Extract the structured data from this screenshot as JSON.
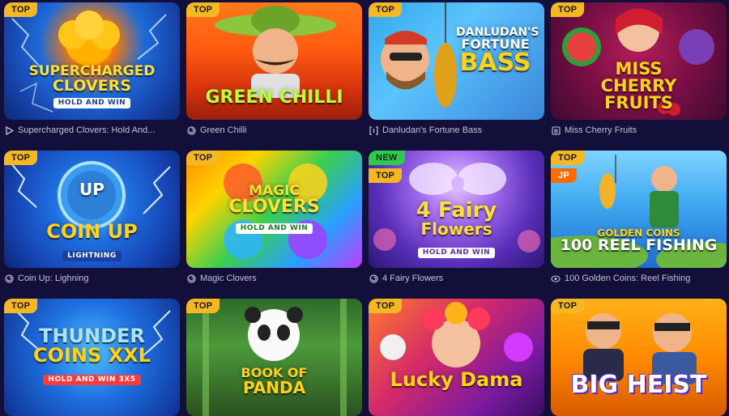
{
  "colors": {
    "page_bg": "#120f3a",
    "badge_top": "#f5b823",
    "badge_new": "#2ecc4d",
    "badge_jp": "#ff6a00",
    "label_text": "#c3c2d6"
  },
  "games": [
    {
      "name": "Supercharged Clovers: Hold And...",
      "provider_icon": "play-triangle-icon",
      "badges": [
        "TOP"
      ],
      "art_title_lines": [
        "SUPERCHARGED",
        "CLOVERS"
      ],
      "art_subtitle": "HOLD AND WIN"
    },
    {
      "name": "Green Chilli",
      "provider_icon": "spiral-provider-icon",
      "badges": [
        "TOP"
      ],
      "art_title_lines": [
        "GREEN CHILLI"
      ],
      "art_subtitle": ""
    },
    {
      "name": "Danludan's Fortune Bass",
      "provider_icon": "bracket-provider-icon",
      "badges": [
        "TOP"
      ],
      "art_title_lines": [
        "DANLUDAN'S",
        "FORTUNE",
        "BASS"
      ],
      "art_subtitle": ""
    },
    {
      "name": "Miss Cherry Fruits",
      "provider_icon": "b-provider-icon",
      "badges": [
        "TOP"
      ],
      "art_title_lines": [
        "MISS",
        "CHERRY",
        "FRUITS"
      ],
      "art_subtitle": ""
    },
    {
      "name": "Coin Up: Lighning",
      "provider_icon": "spiral-provider-icon",
      "badges": [
        "TOP"
      ],
      "art_title_lines": [
        "UP",
        "COIN UP"
      ],
      "art_subtitle": "LIGHTNING"
    },
    {
      "name": "Magic Clovers",
      "provider_icon": "spiral-provider-icon",
      "badges": [
        "TOP"
      ],
      "art_title_lines": [
        "MAGIC",
        "CLOVERS"
      ],
      "art_subtitle": "HOLD AND WIN"
    },
    {
      "name": "4 Fairy Flowers",
      "provider_icon": "spiral-provider-icon",
      "badges": [
        "NEW",
        "TOP"
      ],
      "art_title_lines": [
        "4 Fairy",
        "Flowers"
      ],
      "art_subtitle": "HOLD AND WIN"
    },
    {
      "name": "100 Golden Coins: Reel Fishing",
      "provider_icon": "eye-provider-icon",
      "badges": [
        "TOP",
        "JP"
      ],
      "art_title_lines": [
        "GOLDEN COINS",
        "100 REEL FISHING"
      ],
      "art_subtitle": ""
    },
    {
      "name": "Thunder Coins XXL",
      "provider_icon": "spiral-provider-icon",
      "badges": [
        "TOP"
      ],
      "art_title_lines": [
        "THUNDER",
        "COINS XXL"
      ],
      "art_subtitle": "HOLD AND WIN 3X5"
    },
    {
      "name": "Book of Panda",
      "provider_icon": "spiral-provider-icon",
      "badges": [
        "TOP"
      ],
      "art_title_lines": [
        "BOOK OF",
        "PANDA"
      ],
      "art_subtitle": ""
    },
    {
      "name": "Lucky Dama",
      "provider_icon": "spiral-provider-icon",
      "badges": [
        "TOP"
      ],
      "art_title_lines": [
        "Lucky Dama"
      ],
      "art_subtitle": ""
    },
    {
      "name": "Big Heist",
      "provider_icon": "spiral-provider-icon",
      "badges": [
        "TOP"
      ],
      "art_title_lines": [
        "BIG HEIST"
      ],
      "art_subtitle": ""
    }
  ]
}
